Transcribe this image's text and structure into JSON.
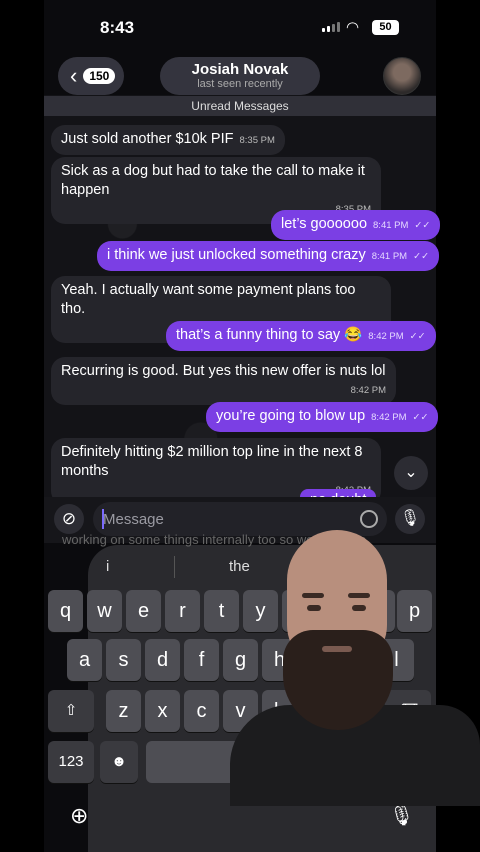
{
  "status_bar": {
    "time": "8:43",
    "battery": "50"
  },
  "header": {
    "back_count": "150",
    "contact_name": "Josiah Novak",
    "last_seen": "last seen recently"
  },
  "unread_banner": "Unread Messages",
  "messages": [
    {
      "direction": "in",
      "text": "Just sold another $10k PIF",
      "time": "8:35 PM"
    },
    {
      "direction": "in",
      "text": "Sick as a dog but had to take the call to make it happen",
      "time": "8:35 PM"
    },
    {
      "direction": "out",
      "text": "let’s goooooo",
      "time": "8:41 PM"
    },
    {
      "direction": "out",
      "text": "i think we just unlocked something crazy",
      "time": "8:41 PM"
    },
    {
      "direction": "in",
      "text": "Yeah. I actually want some payment plans too tho.",
      "time": "8:42 PM"
    },
    {
      "direction": "out",
      "text": "that’s a funny thing to say 😂",
      "time": "8:42 PM"
    },
    {
      "direction": "in",
      "text": "Recurring is good. But yes this new offer is nuts lol",
      "time": "8:42 PM"
    },
    {
      "direction": "out",
      "text": "you’re going to blow up",
      "time": "8:42 PM"
    },
    {
      "direction": "in",
      "text": "Definitely hitting $2 million top line in the next 8 months",
      "time": "8:43 PM"
    },
    {
      "direction": "out",
      "text": "no doubt",
      "time": ""
    },
    {
      "direction": "in",
      "text": "working on some things internally too so we can take",
      "time": ""
    }
  ],
  "composer": {
    "placeholder": "Message"
  },
  "keyboard": {
    "suggestions": [
      "i",
      "the"
    ],
    "row1": [
      "q",
      "w",
      "e",
      "r",
      "t",
      "y",
      "u",
      "i",
      "o",
      "p"
    ],
    "row2": [
      "a",
      "s",
      "d",
      "f",
      "g",
      "h",
      "j",
      "k",
      "l"
    ],
    "row3": [
      "z",
      "x",
      "c",
      "v",
      "b",
      "n",
      "m"
    ],
    "numbers_label": "123",
    "emoji": "☻",
    "shift": "⇧",
    "delete": "⌫",
    "return": "↵"
  },
  "icons": [
    "back-chevron-icon",
    "paperclip-icon",
    "sticker-icon",
    "microphone-icon",
    "globe-icon",
    "chevron-down-icon"
  ],
  "colors": {
    "outgoing_bubble": "#7b3fe4",
    "incoming_bubble": "#25252b",
    "background": "#131317"
  }
}
